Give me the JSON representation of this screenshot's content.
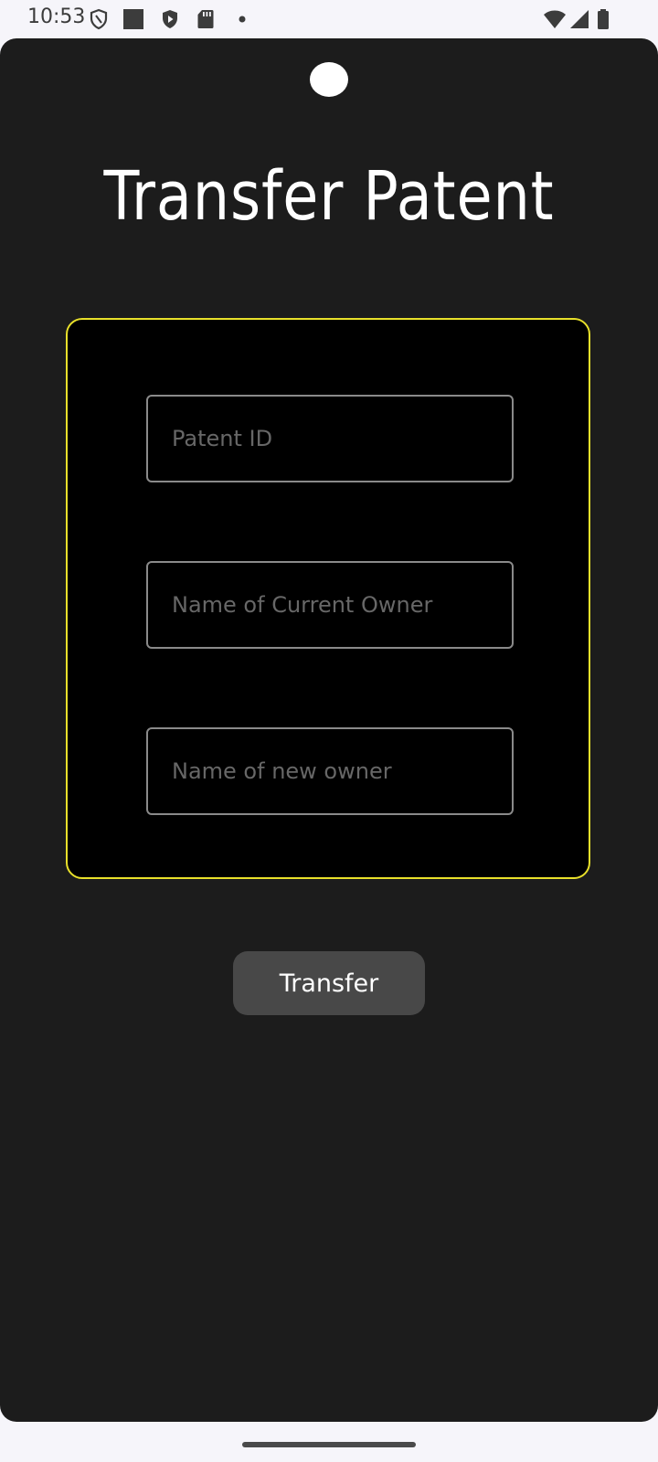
{
  "status_bar": {
    "time": "10:53",
    "left_icons": [
      "shield-outline-icon",
      "square-icon",
      "play-shield-icon",
      "sd-card-icon",
      "dot-icon"
    ],
    "right_icons": [
      "wifi-icon",
      "signal-icon",
      "battery-icon"
    ]
  },
  "page": {
    "title": "Transfer Patent"
  },
  "form": {
    "border_color": "#e8e02a",
    "fields": [
      {
        "placeholder": "Patent ID",
        "value": ""
      },
      {
        "placeholder": "Name of Current Owner",
        "value": ""
      },
      {
        "placeholder": "Name of new owner",
        "value": ""
      }
    ]
  },
  "actions": {
    "transfer_label": "Transfer"
  },
  "colors": {
    "background": "#1c1c1c",
    "card": "#000000",
    "accent": "#e8e02a",
    "button": "#484848"
  }
}
